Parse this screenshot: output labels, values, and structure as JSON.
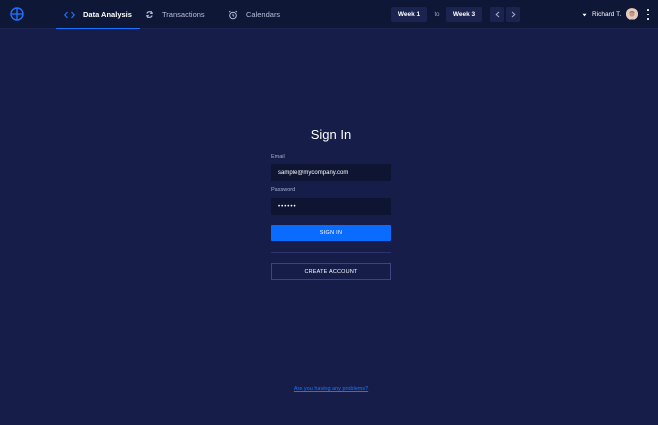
{
  "colors": {
    "background": "#151d48",
    "topbar": "#0f1737",
    "accent": "#1a73ff",
    "primary_button": "#0a6cff",
    "input_background": "#0e1533"
  },
  "header": {
    "logo_icon": "circle-split-logo",
    "tabs": [
      {
        "label": "Data Analysis",
        "icon": "code-brackets-icon",
        "active": true
      },
      {
        "label": "Transactions",
        "icon": "refresh-icon",
        "active": false
      },
      {
        "label": "Calendars",
        "icon": "alarm-clock-icon",
        "active": false
      }
    ],
    "week_from": "Week 1",
    "week_to_label": "to",
    "week_to": "Week 3",
    "user_name": "Richard T."
  },
  "signin": {
    "title": "Sign In",
    "email_label": "Email",
    "email_value": "sample@mycompany.com",
    "password_label": "Password",
    "password_value": "••••••",
    "signin_button": "SIGN IN",
    "create_account_button": "CREATE ACCOUNT",
    "help_link": "Are you having any problems?"
  }
}
